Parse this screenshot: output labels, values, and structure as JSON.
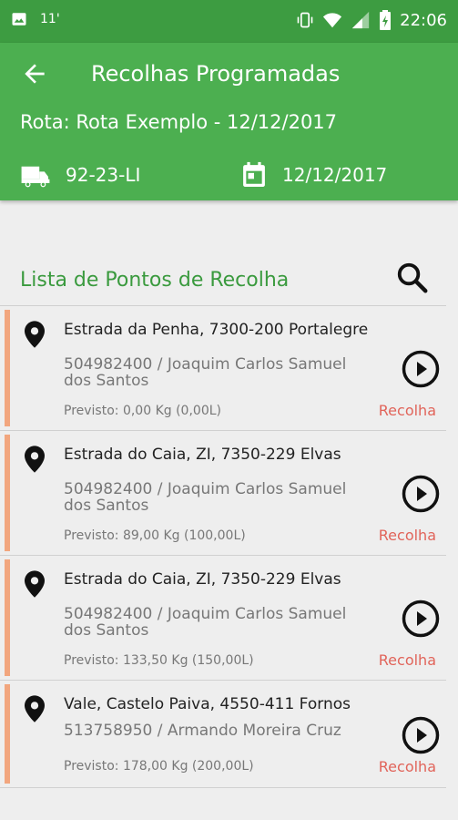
{
  "status_bar": {
    "left_indicator": "11'",
    "time": "22:06",
    "icons": [
      "image-icon",
      "vibrate-icon",
      "wifi-icon",
      "signal-icon",
      "battery-icon"
    ]
  },
  "app_bar": {
    "title": "Recolhas Programadas",
    "route_label": "Rota: Rota Exemplo - 12/12/2017",
    "plate": "92-23-LI",
    "date": "12/12/2017"
  },
  "section": {
    "title": "Lista de Pontos de Recolha"
  },
  "points": [
    {
      "address": "Estrada da Penha, 7300-200 Portalegre",
      "client": "504982400 / Joaquim Carlos Samuel dos Santos",
      "forecast": "Previsto: 0,00 Kg (0,00L)",
      "tag": "Recolha"
    },
    {
      "address": "Estrada do Caia, ZI, 7350-229 Elvas",
      "client": "504982400 / Joaquim Carlos Samuel dos Santos",
      "forecast": "Previsto: 89,00 Kg (100,00L)",
      "tag": "Recolha"
    },
    {
      "address": "Estrada do Caia, ZI, 7350-229 Elvas",
      "client": "504982400 / Joaquim Carlos Samuel dos Santos",
      "forecast": "Previsto: 133,50 Kg (150,00L)",
      "tag": "Recolha"
    },
    {
      "address": "Vale, Castelo Paiva, 4550-411 Fornos",
      "client": "513758950 / Armando Moreira Cruz",
      "forecast": "Previsto: 178,00 Kg (200,00L)",
      "tag": "Recolha"
    }
  ],
  "colors": {
    "status_bar": "#3d9c41",
    "app_bar": "#4caf50",
    "section_title": "#3a9a3e",
    "accent_bar": "#f2a67e",
    "tag": "#e1645a"
  }
}
